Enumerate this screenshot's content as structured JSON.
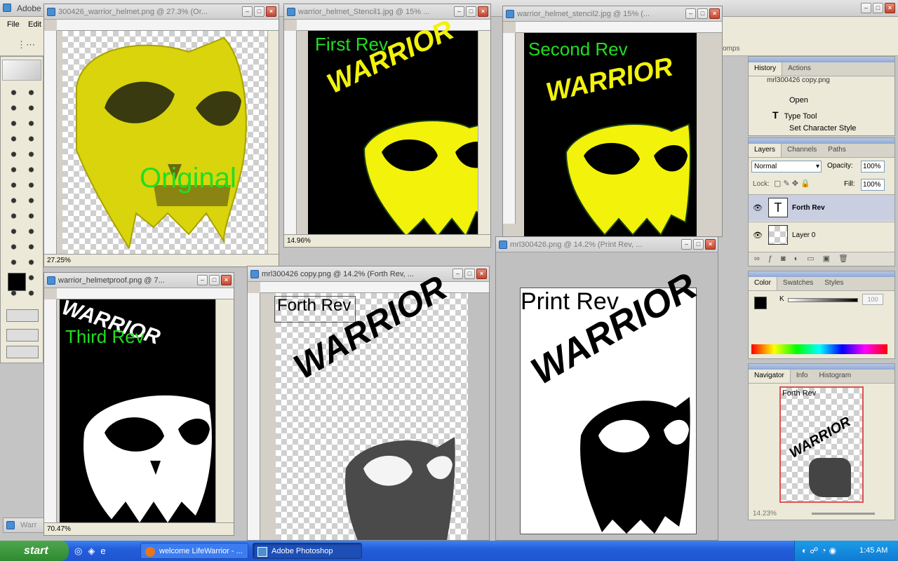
{
  "app": {
    "title_fragment": "Adobe",
    "menu": [
      "File",
      "Edit"
    ]
  },
  "docs": {
    "original": {
      "title": "300426_warrior_helmet.png @ 27.3% (Or...",
      "zoom": "27.25%",
      "label": "Original"
    },
    "stencil1": {
      "title": "warrior_helmet_Stencil1.jpg @ 15% ...",
      "zoom": "14.96%",
      "label": "First Rev"
    },
    "stencil2": {
      "title": "warrior_helmet_stencil2.jpg @ 15% (...",
      "label": "Second Rev"
    },
    "proof": {
      "title": "warrior_helmetproof.png @ 7...",
      "zoom": "70.47%",
      "label": "Third Rev"
    },
    "copy": {
      "title": "mrl300426 copy.png @ 14.2% (Forth Rev, ...",
      "label": "Forth Rev"
    },
    "print": {
      "title": "mrl300426.png @ 14.2% (Print Rev, ...",
      "label": "Print Rev"
    }
  },
  "art_word": "WARRIOR",
  "panels": {
    "history": {
      "tabs": [
        "History",
        "Actions"
      ],
      "items": [
        "mrl300426 copy.png",
        "Open",
        "Type Tool",
        "Set Character Style"
      ]
    },
    "layers": {
      "tabs": [
        "Layers",
        "Channels",
        "Paths"
      ],
      "blend_mode": "Normal",
      "opacity_label": "Opacity:",
      "opacity": "100%",
      "lock_label": "Lock:",
      "fill_label": "Fill:",
      "fill": "100%",
      "layers": [
        "Forth Rev",
        "Layer 0"
      ]
    },
    "color": {
      "tabs": [
        "Color",
        "Swatches",
        "Styles"
      ],
      "channel": "K",
      "value": "100"
    },
    "navigator": {
      "tabs": [
        "Navigator",
        "Info",
        "Histogram"
      ],
      "zoom": "14.23%",
      "preview_label": "Forth Rev"
    },
    "brushes_fragment": "omps"
  },
  "taskbar": {
    "start": "start",
    "tasks": [
      "welcome LifeWarrior - ...",
      "Adobe Photoshop"
    ],
    "clock": "1:45 AM"
  },
  "colors": {
    "helmet_yellow": "#f2f20a",
    "green_label": "#22dd22"
  }
}
